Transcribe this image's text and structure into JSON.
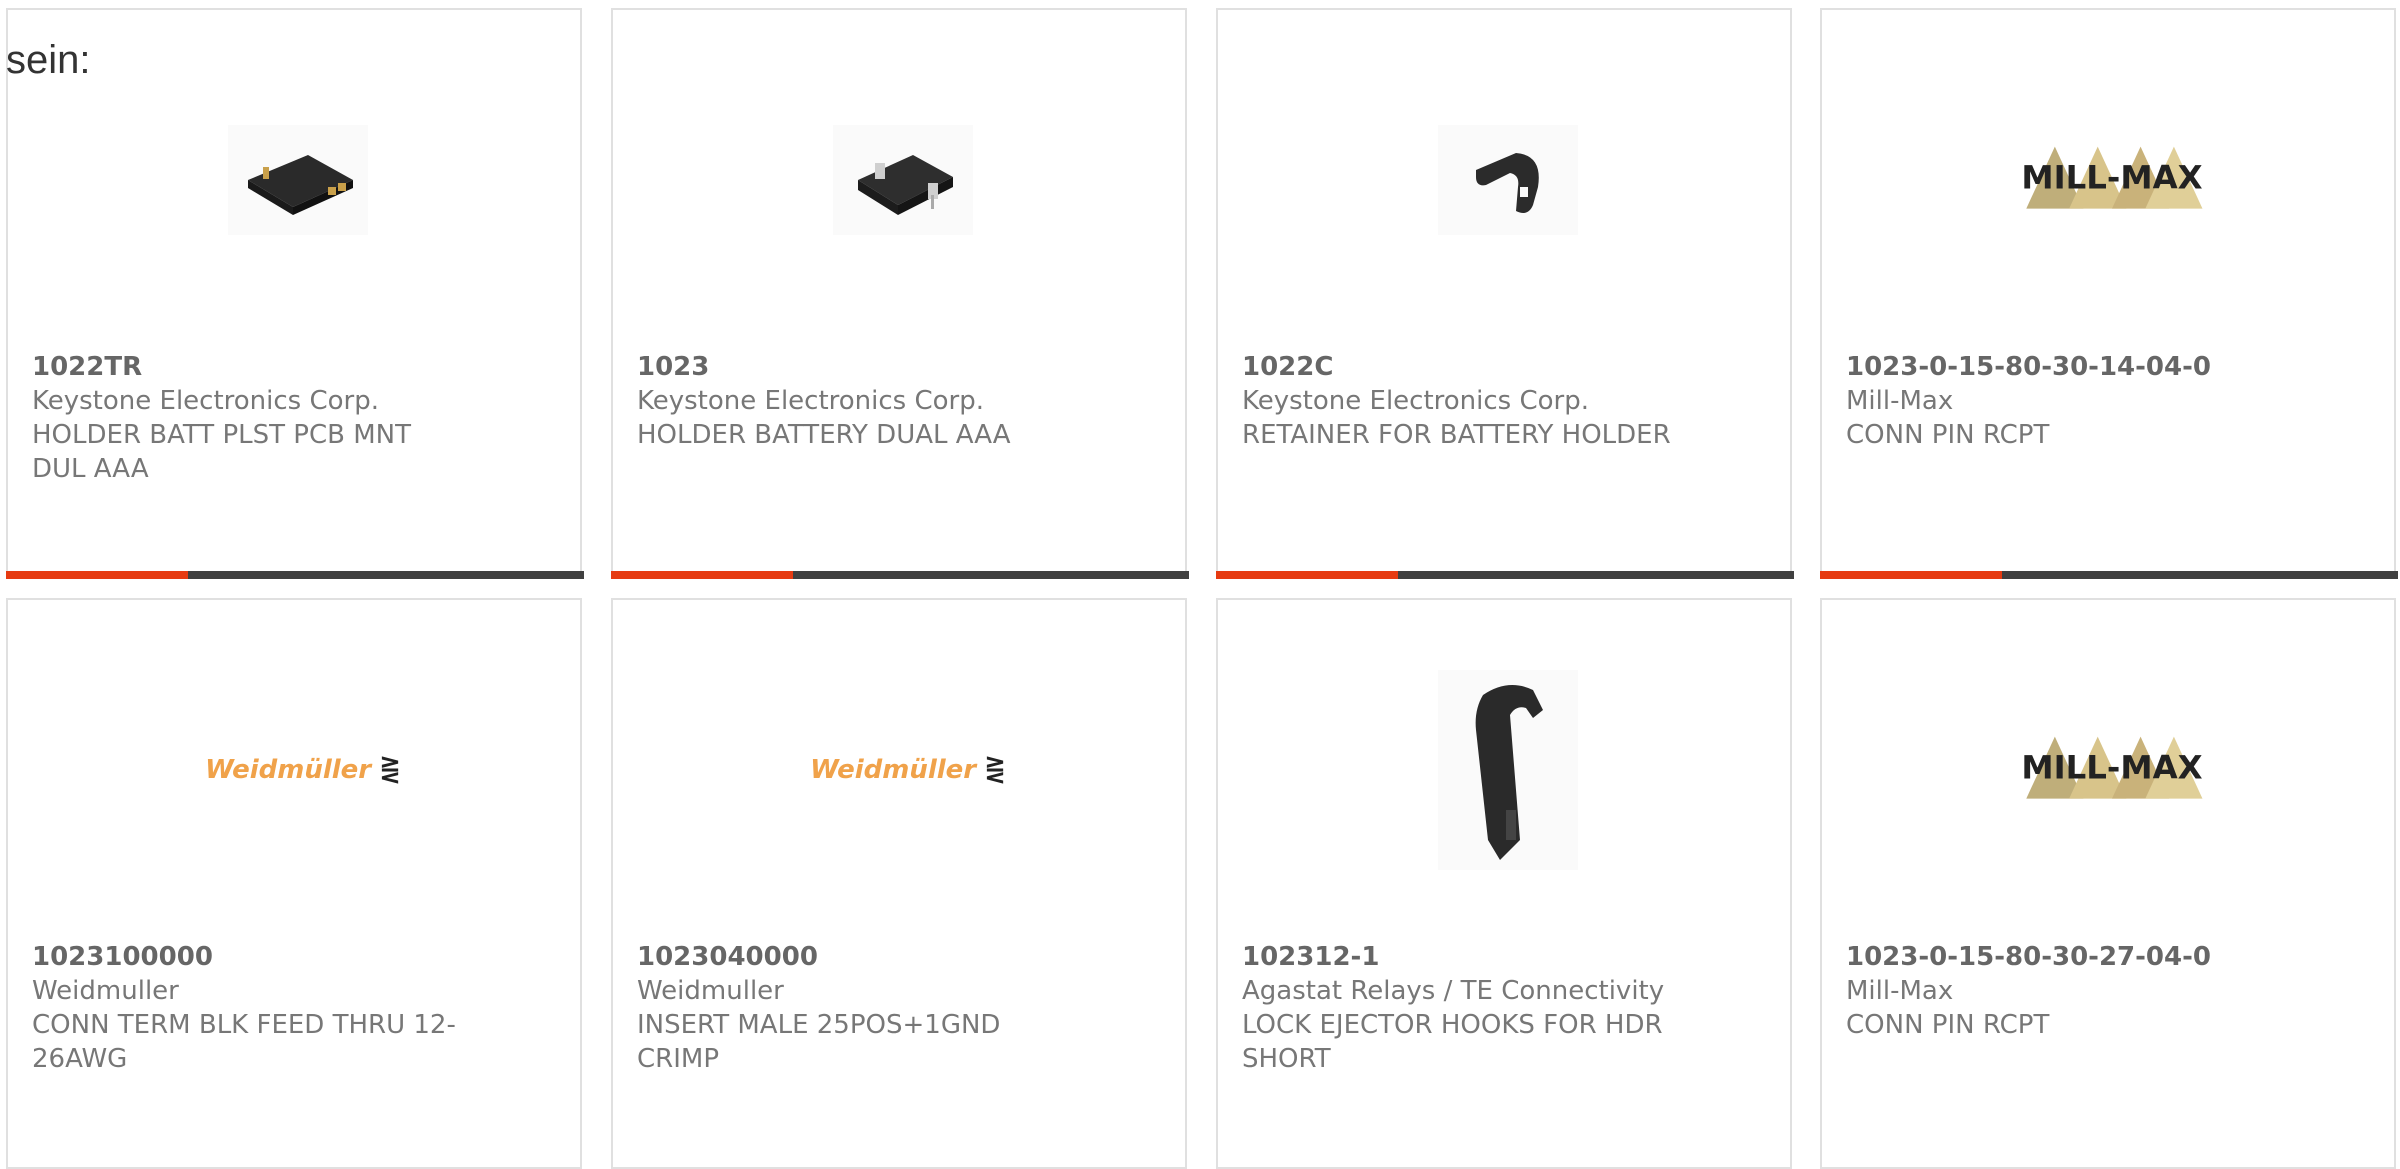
{
  "lead_text": "sein:",
  "cards": [
    {
      "part": "1022TR",
      "mfr": "Keystone Electronics Corp.",
      "desc": "HOLDER BATT PLST PCB MNT DUL AAA",
      "image": "battery-holder-icon",
      "bar": true
    },
    {
      "part": "1023",
      "mfr": "Keystone Electronics Corp.",
      "desc": "HOLDER BATTERY DUAL AAA",
      "image": "battery-holder-icon",
      "bar": true
    },
    {
      "part": "1022C",
      "mfr": "Keystone Electronics Corp.",
      "desc": "RETAINER FOR BATTERY HOLDER",
      "image": "retainer-clip-icon",
      "bar": true
    },
    {
      "part": "1023-0-15-80-30-14-04-0",
      "mfr": "Mill-Max",
      "desc": "CONN PIN RCPT",
      "image": "mill-max-logo",
      "logo_text": "MILL-MAX",
      "bar": true
    },
    {
      "part": "1023100000",
      "mfr": "Weidmuller",
      "desc": "CONN TERM BLK FEED THRU 12-26AWG",
      "image": "weidmuller-logo",
      "logo_text": "Weidmüller",
      "bar": false
    },
    {
      "part": "1023040000",
      "mfr": "Weidmuller",
      "desc": "INSERT MALE 25POS+1GND CRIMP",
      "image": "weidmuller-logo",
      "logo_text": "Weidmüller",
      "bar": false
    },
    {
      "part": "102312-1",
      "mfr": "Agastat Relays / TE Connectivity",
      "desc": "LOCK EJECTOR HOOKS FOR HDR SHORT",
      "image": "ejector-hook-icon",
      "bar": false
    },
    {
      "part": "1023-0-15-80-30-27-04-0",
      "mfr": "Mill-Max",
      "desc": "CONN PIN RCPT",
      "image": "mill-max-logo",
      "logo_text": "MILL-MAX",
      "bar": false
    }
  ],
  "colors": {
    "accent": "#e63b12",
    "bar_dark": "#404040",
    "border": "#e0e0e0",
    "weidmuller": "#f0a24a"
  }
}
